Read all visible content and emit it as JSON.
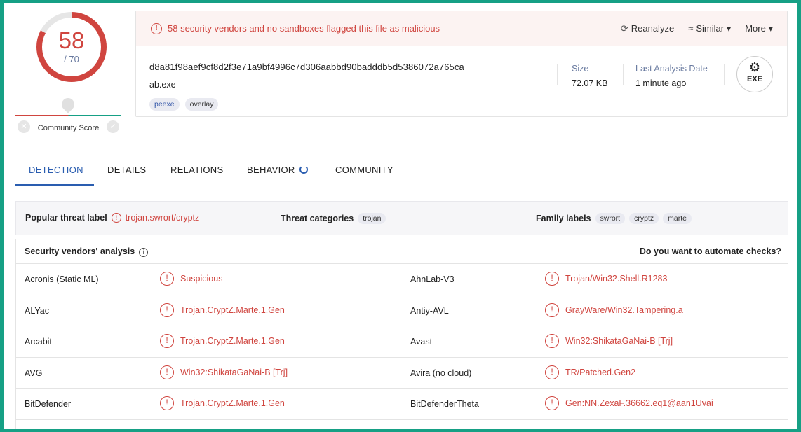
{
  "score": {
    "detections": "58",
    "total": "/ 70",
    "community_label": "Community Score"
  },
  "alert": {
    "text": "58 security vendors and no sandboxes flagged this file as malicious"
  },
  "actions": {
    "reanalyze": "Reanalyze",
    "similar": "Similar",
    "more": "More"
  },
  "file": {
    "hash": "d8a81f98aef9cf8d2f3e71a9bf4996c7d306aabbd90badddb5d5386072a765ca",
    "name": "ab.exe",
    "tags": [
      "peexe",
      "overlay"
    ],
    "size_label": "Size",
    "size_value": "72.07 KB",
    "date_label": "Last Analysis Date",
    "date_value": "1 minute ago",
    "type_badge": "EXE"
  },
  "tabs": [
    "DETECTION",
    "DETAILS",
    "RELATIONS",
    "BEHAVIOR",
    "COMMUNITY"
  ],
  "threat": {
    "popular_label": "Popular threat label",
    "popular_value": "trojan.swrort/cryptz",
    "categories_label": "Threat categories",
    "categories": [
      "trojan"
    ],
    "family_label": "Family labels",
    "families": [
      "swrort",
      "cryptz",
      "marte"
    ]
  },
  "analysis": {
    "title": "Security vendors' analysis",
    "automate": "Do you want to automate checks?",
    "rows": [
      {
        "v1": "Acronis (Static ML)",
        "r1": "Suspicious",
        "v2": "AhnLab-V3",
        "r2": "Trojan/Win32.Shell.R1283"
      },
      {
        "v1": "ALYac",
        "r1": "Trojan.CryptZ.Marte.1.Gen",
        "v2": "Antiy-AVL",
        "r2": "GrayWare/Win32.Tampering.a"
      },
      {
        "v1": "Arcabit",
        "r1": "Trojan.CryptZ.Marte.1.Gen",
        "v2": "Avast",
        "r2": "Win32:ShikataGaNai-B [Trj]"
      },
      {
        "v1": "AVG",
        "r1": "Win32:ShikataGaNai-B [Trj]",
        "v2": "Avira (no cloud)",
        "r2": "TR/Patched.Gen2"
      },
      {
        "v1": "BitDefender",
        "r1": "Trojan.CryptZ.Marte.1.Gen",
        "v2": "BitDefenderTheta",
        "r2": "Gen:NN.ZexaF.36662.eq1@aan1Uvai"
      }
    ]
  },
  "colors": {
    "malicious": "#d0453f",
    "accent": "#2a5db0",
    "border": "#16a085"
  }
}
